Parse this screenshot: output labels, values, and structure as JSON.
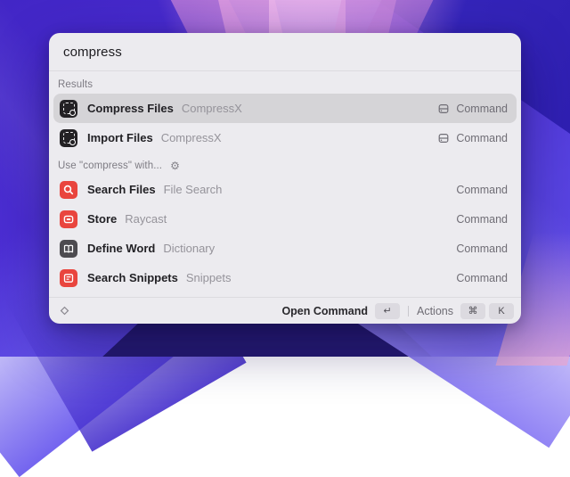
{
  "colors": {
    "accent_red": "#E9453E",
    "icon_dark_bg": "#232124",
    "icon_gray_bg": "#4D4B50",
    "window_bg": "#ECEBEF",
    "selected_row_bg": "#D5D4D7"
  },
  "search": {
    "value": "compress"
  },
  "sections": [
    {
      "label": "Results"
    },
    {
      "label": "Use \"compress\" with..."
    }
  ],
  "rows": [
    {
      "icon": "compressx-icon",
      "title": "Compress Files",
      "subtitle": "CompressX",
      "accessory": "Command",
      "selected": true
    },
    {
      "icon": "compressx-icon",
      "title": "Import Files",
      "subtitle": "CompressX",
      "accessory": "Command",
      "selected": false
    },
    {
      "icon": "file-search-icon",
      "title": "Search Files",
      "subtitle": "File Search",
      "accessory": "Command",
      "selected": false
    },
    {
      "icon": "raycast-store-icon",
      "title": "Store",
      "subtitle": "Raycast",
      "accessory": "Command",
      "selected": false
    },
    {
      "icon": "dictionary-icon",
      "title": "Define Word",
      "subtitle": "Dictionary",
      "accessory": "Command",
      "selected": false
    },
    {
      "icon": "snippets-icon",
      "title": "Search Snippets",
      "subtitle": "Snippets",
      "accessory": "Command",
      "selected": false
    }
  ],
  "icons": {
    "gear": "⚙"
  },
  "footer": {
    "open_command": "Open Command",
    "return_key": "↵",
    "actions": "Actions",
    "cmd_key": "⌘",
    "k_key": "K"
  }
}
